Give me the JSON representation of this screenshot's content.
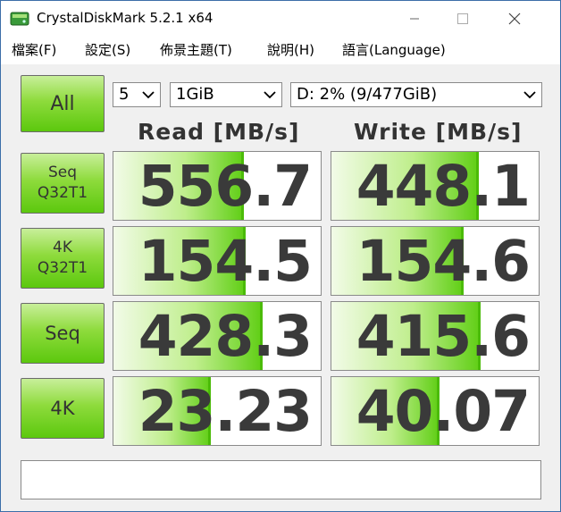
{
  "window": {
    "title": "CrystalDiskMark 5.2.1 x64",
    "icons": {
      "app": "crystaldiskmark-disk-icon",
      "minimize": "minimize-icon",
      "maximize": "maximize-icon",
      "close": "close-icon"
    }
  },
  "menu": {
    "items": [
      "檔案(F)",
      "設定(S)",
      "佈景主題(T)",
      "說明(H)",
      "語言(Language)"
    ]
  },
  "controls": {
    "all_label": "All",
    "count": "5",
    "size": "1GiB",
    "drive": "D: 2% (9/477GiB)",
    "dropdown_icon": "chevron-down-icon"
  },
  "headers": {
    "read": "Read [MB/s]",
    "write": "Write [MB/s]"
  },
  "rows": [
    {
      "label_line1": "Seq",
      "label_line2": "Q32T1",
      "read": "556.7",
      "write": "448.1",
      "read_fill": 0.63,
      "write_fill": 0.71
    },
    {
      "label_line1": "4K",
      "label_line2": "Q32T1",
      "read": "154.5",
      "write": "154.6",
      "read_fill": 0.64,
      "write_fill": 0.64
    },
    {
      "label_line1": "Seq",
      "label_line2": "",
      "read": "428.3",
      "write": "415.6",
      "read_fill": 0.72,
      "write_fill": 0.72
    },
    {
      "label_line1": "4K",
      "label_line2": "",
      "read": "23.23",
      "write": "40.07",
      "read_fill": 0.47,
      "write_fill": 0.52
    }
  ],
  "status": {
    "text": ""
  },
  "colors": {
    "accent_green": "#5cc80e",
    "light_green": "#c8ef9a",
    "value_text": "#3a3a3a",
    "background": "#f0f0f0"
  }
}
